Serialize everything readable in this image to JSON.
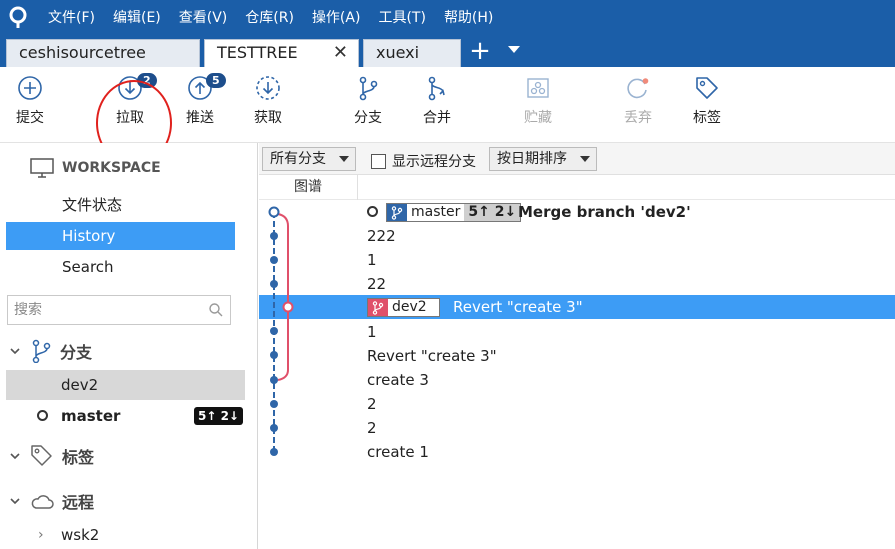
{
  "menu": [
    "文件(F)",
    "编辑(E)",
    "查看(V)",
    "仓库(R)",
    "操作(A)",
    "工具(T)",
    "帮助(H)"
  ],
  "tabs": [
    {
      "label": "ceshisourcetree",
      "active": false
    },
    {
      "label": "TESTTREE",
      "active": true
    },
    {
      "label": "xuexi",
      "active": false
    }
  ],
  "tab_close": "✕",
  "tab_add": "+",
  "toolbar": {
    "commit": "提交",
    "pull": "拉取",
    "pull_badge": "2",
    "push": "推送",
    "push_badge": "5",
    "fetch": "获取",
    "branch": "分支",
    "merge": "合并",
    "stash": "贮藏",
    "discard": "丢弃",
    "tag": "标签"
  },
  "sidebar": {
    "workspace": "WORKSPACE",
    "links": [
      "文件状态",
      "History",
      "Search"
    ],
    "selected_link": "History",
    "search_placeholder": "搜索",
    "branches_title": "分支",
    "branches": [
      {
        "name": "dev2",
        "current": false
      },
      {
        "name": "master",
        "current": true,
        "badge": "5↑ 2↓"
      }
    ],
    "tags_title": "标签",
    "remotes_title": "远程",
    "remotes": [
      "wsk2"
    ]
  },
  "filters": {
    "branches": "所有分支",
    "show_remote": "显示远程分支",
    "sort": "按日期排序"
  },
  "columns": {
    "graph": "图谱"
  },
  "commits": [
    {
      "message": "Merge branch 'dev2'",
      "ref": "master",
      "ref_count": "5↑ 2↓",
      "head": true
    },
    {
      "message": "222"
    },
    {
      "message": "1"
    },
    {
      "message": "22"
    },
    {
      "message": "Revert \"create 3\"",
      "ref": "dev2",
      "selected": true
    },
    {
      "message": "1"
    },
    {
      "message": "Revert \"create 3\""
    },
    {
      "message": "create 3"
    },
    {
      "message": "2"
    },
    {
      "message": "2"
    },
    {
      "message": "create 1"
    }
  ],
  "colors": {
    "menubar": "#1b5ea8",
    "selection": "#3d9cf5",
    "graph_main": "#2f66a8",
    "graph_branch": "#e0506a",
    "annotation": "#e0211d"
  }
}
